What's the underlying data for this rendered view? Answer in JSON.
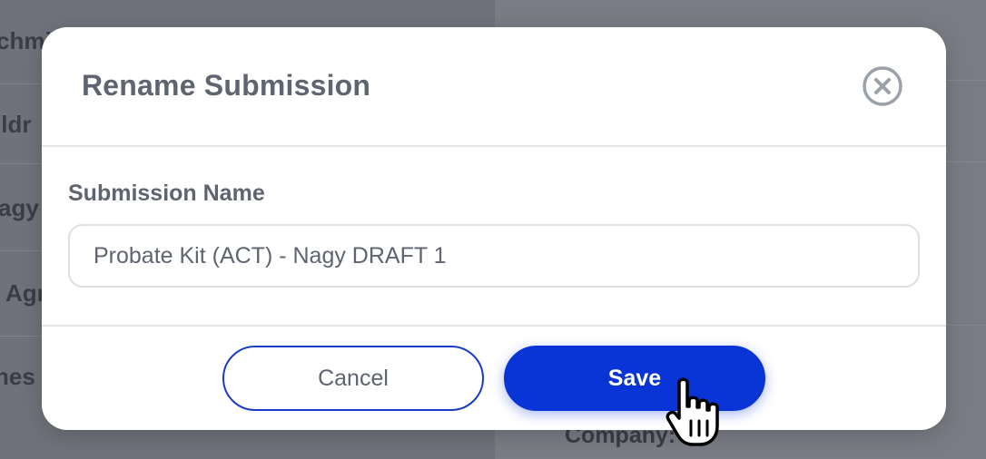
{
  "background": {
    "rows": [
      "chmi",
      "ildr",
      "agy",
      "Agr",
      "nes :"
    ],
    "right_label": "Company:"
  },
  "modal": {
    "title": "Rename Submission",
    "close_icon": "close-circle-icon",
    "field_label": "Submission Name",
    "field_value": "Probate Kit (ACT) - Nagy DRAFT 1",
    "cancel_label": "Cancel",
    "save_label": "Save"
  },
  "colors": {
    "primary": "#0a35d6",
    "text": "#5e6470",
    "overlay": "#6f727a"
  },
  "cursor_icon": "hand-pointer-icon"
}
